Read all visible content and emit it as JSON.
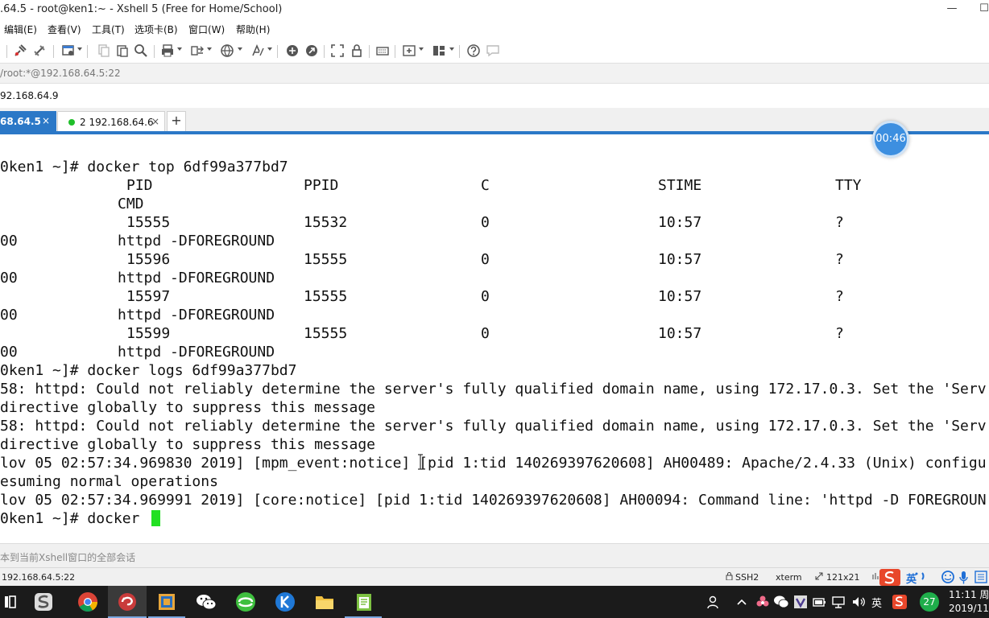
{
  "window": {
    "title": ".64.5 - root@ken1:~ - Xshell 5 (Free for Home/School)",
    "minimize_glyph": "—",
    "maximize_glyph": "☐"
  },
  "menu": [
    {
      "label": "编辑(E)"
    },
    {
      "label": "查看(V)"
    },
    {
      "label": "工具(T)"
    },
    {
      "label": "选项卡(B)"
    },
    {
      "label": "窗口(W)"
    },
    {
      "label": "帮助(H)"
    }
  ],
  "address": "/root:*@192.168.64.5:22",
  "link": "92.168.64.9",
  "tabs": [
    {
      "label": "68.64.5",
      "close": "×",
      "active": true
    },
    {
      "label": "2 192.168.64.6",
      "close": "×",
      "active": false
    }
  ],
  "tab_add": "+",
  "timer": "00:46",
  "terminal": {
    "lines": [
      {
        "text": "0ken1 ~]# docker top 6df99a377bd7"
      },
      {
        "cols": [
          "",
          "PID",
          "PPID",
          "C",
          "STIME",
          "TTY"
        ]
      },
      {
        "cols": [
          "",
          "CMD"
        ]
      },
      {
        "cols": [
          "",
          "15555",
          "15532",
          "0",
          "10:57",
          "?"
        ]
      },
      {
        "cols": [
          "00",
          "httpd -DFOREGROUND"
        ]
      },
      {
        "cols": [
          "",
          "15596",
          "15555",
          "0",
          "10:57",
          "?"
        ]
      },
      {
        "cols": [
          "00",
          "httpd -DFOREGROUND"
        ]
      },
      {
        "cols": [
          "",
          "15597",
          "15555",
          "0",
          "10:57",
          "?"
        ]
      },
      {
        "cols": [
          "00",
          "httpd -DFOREGROUND"
        ]
      },
      {
        "cols": [
          "",
          "15599",
          "15555",
          "0",
          "10:57",
          "?"
        ]
      },
      {
        "cols": [
          "00",
          "httpd -DFOREGROUND"
        ]
      },
      {
        "text": "0ken1 ~]# docker logs 6df99a377bd7"
      },
      {
        "text": "58: httpd: Could not reliably determine the server's fully qualified domain name, using 172.17.0.3. Set the 'Serv"
      },
      {
        "text": "directive globally to suppress this message"
      },
      {
        "text": "58: httpd: Could not reliably determine the server's fully qualified domain name, using 172.17.0.3. Set the 'Serv"
      },
      {
        "text": "directive globally to suppress this message"
      },
      {
        "text": "lov 05 02:57:34.969830 2019] [mpm_event:notice] [pid 1:tid 140269397620608] AH00489: Apache/2.4.33 (Unix) configu"
      },
      {
        "text": "esuming normal operations"
      },
      {
        "text": "lov 05 02:57:34.969991 2019] [core:notice] [pid 1:tid 140269397620608] AH00094: Command line: 'httpd -D FOREGROUN"
      },
      {
        "text": "0ken1 ~]# docker "
      }
    ]
  },
  "send_bar": "本到当前Xshell窗口的全部会话",
  "status": {
    "host": "192.168.64.5:22",
    "protocol": "SSH2",
    "term": "xterm",
    "size": "121x21",
    "ime_lang": "英"
  },
  "taskbar": {
    "tray_lang": "英",
    "badge": "27",
    "clock_time": "11:11 周",
    "clock_date": "2019/11/"
  },
  "colors": {
    "accent": "#2b78c7",
    "cursor": "#22e022",
    "online_dot": "#1fbf2a",
    "taskbar": "#1b1b1b"
  }
}
